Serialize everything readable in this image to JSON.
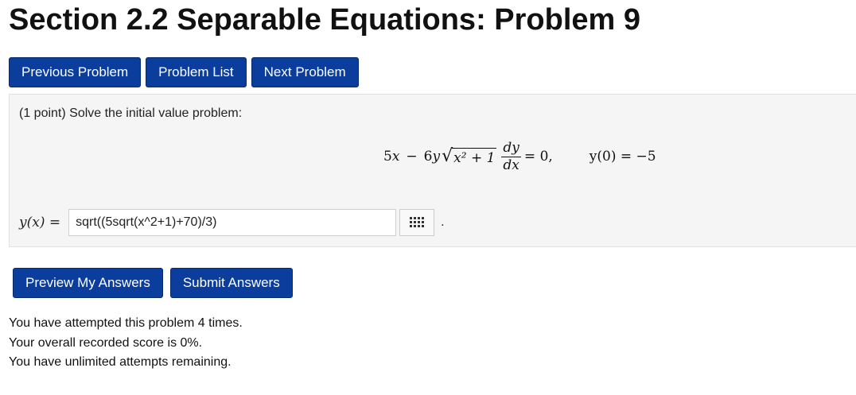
{
  "page": {
    "title": "Section 2.2 Separable Equations: Problem 9"
  },
  "nav": {
    "previous_label": "Previous Problem",
    "list_label": "Problem List",
    "next_label": "Next Problem"
  },
  "problem": {
    "prompt": "(1 point) Solve the initial value problem:",
    "equation": {
      "lhs_a": "5",
      "lhs_minus": "−",
      "lhs_b": "6",
      "under_root": "x² + 1",
      "deriv_num": "dy",
      "deriv_den": "dx",
      "equals_zero": "= 0,",
      "initial_condition": "y(0) = −5"
    },
    "answer_label": "y(x) =",
    "answer_value": "sqrt((5sqrt(x^2+1)+70)/3)",
    "answer_suffix": ".",
    "equation_editor_icon": "grid-icon"
  },
  "actions": {
    "preview_label": "Preview My Answers",
    "submit_label": "Submit Answers"
  },
  "status": {
    "line1": "You have attempted this problem 4 times.",
    "line2": "Your overall recorded score is 0%.",
    "line3": "You have unlimited attempts remaining."
  },
  "colors": {
    "button_bg": "#0a3d9c",
    "panel_bg": "#f5f5f5"
  }
}
